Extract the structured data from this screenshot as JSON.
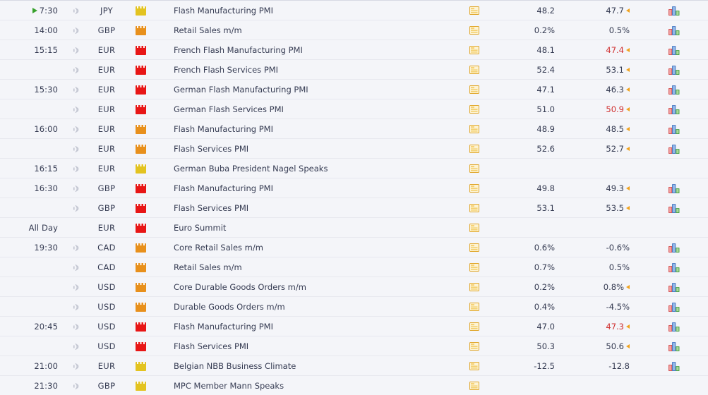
{
  "calendar": {
    "icons": {
      "sound": "speaker-icon",
      "detail": "folder-icon",
      "graph": "bar-graph-icon",
      "now": "now-marker-icon"
    },
    "rows": [
      {
        "time": "7:30",
        "now": true,
        "group_start": true,
        "sound": true,
        "currency": "JPY",
        "impact": "yellow",
        "impact_color": "#e3c320",
        "event": "Flash Manufacturing PMI",
        "detail": true,
        "actual": "48.2",
        "previous": "47.7",
        "previous_revised": false,
        "revision_arrow": true,
        "graph": true
      },
      {
        "time": "14:00",
        "now": false,
        "group_start": true,
        "sound": true,
        "currency": "GBP",
        "impact": "orange",
        "impact_color": "#e8901c",
        "event": "Retail Sales m/m",
        "detail": true,
        "actual": "0.2%",
        "previous": "0.5%",
        "previous_revised": false,
        "revision_arrow": false,
        "graph": true
      },
      {
        "time": "15:15",
        "now": false,
        "group_start": true,
        "sound": true,
        "currency": "EUR",
        "impact": "red",
        "impact_color": "#e81616",
        "event": "French Flash Manufacturing PMI",
        "detail": true,
        "actual": "48.1",
        "previous": "47.4",
        "previous_revised": true,
        "revision_arrow": true,
        "graph": true
      },
      {
        "time": "",
        "now": false,
        "group_start": false,
        "sound": true,
        "currency": "EUR",
        "impact": "red",
        "impact_color": "#e81616",
        "event": "French Flash Services PMI",
        "detail": true,
        "actual": "52.4",
        "previous": "53.1",
        "previous_revised": false,
        "revision_arrow": true,
        "graph": true
      },
      {
        "time": "15:30",
        "now": false,
        "group_start": true,
        "sound": true,
        "currency": "EUR",
        "impact": "red",
        "impact_color": "#e81616",
        "event": "German Flash Manufacturing PMI",
        "detail": true,
        "actual": "47.1",
        "previous": "46.3",
        "previous_revised": false,
        "revision_arrow": true,
        "graph": true
      },
      {
        "time": "",
        "now": false,
        "group_start": false,
        "sound": true,
        "currency": "EUR",
        "impact": "red",
        "impact_color": "#e81616",
        "event": "German Flash Services PMI",
        "detail": true,
        "actual": "51.0",
        "previous": "50.9",
        "previous_revised": true,
        "revision_arrow": true,
        "graph": true
      },
      {
        "time": "16:00",
        "now": false,
        "group_start": true,
        "sound": true,
        "currency": "EUR",
        "impact": "orange",
        "impact_color": "#e8901c",
        "event": "Flash Manufacturing PMI",
        "detail": true,
        "actual": "48.9",
        "previous": "48.5",
        "previous_revised": false,
        "revision_arrow": true,
        "graph": true
      },
      {
        "time": "",
        "now": false,
        "group_start": false,
        "sound": true,
        "currency": "EUR",
        "impact": "orange",
        "impact_color": "#e8901c",
        "event": "Flash Services PMI",
        "detail": true,
        "actual": "52.6",
        "previous": "52.7",
        "previous_revised": false,
        "revision_arrow": true,
        "graph": true
      },
      {
        "time": "16:15",
        "now": false,
        "group_start": true,
        "sound": true,
        "currency": "EUR",
        "impact": "yellow",
        "impact_color": "#e3c320",
        "event": "German Buba President Nagel Speaks",
        "detail": true,
        "actual": "",
        "previous": "",
        "previous_revised": false,
        "revision_arrow": false,
        "graph": false
      },
      {
        "time": "16:30",
        "now": false,
        "group_start": true,
        "sound": true,
        "currency": "GBP",
        "impact": "red",
        "impact_color": "#e81616",
        "event": "Flash Manufacturing PMI",
        "detail": true,
        "actual": "49.8",
        "previous": "49.3",
        "previous_revised": false,
        "revision_arrow": true,
        "graph": true
      },
      {
        "time": "",
        "now": false,
        "group_start": false,
        "sound": true,
        "currency": "GBP",
        "impact": "red",
        "impact_color": "#e81616",
        "event": "Flash Services PMI",
        "detail": true,
        "actual": "53.1",
        "previous": "53.5",
        "previous_revised": false,
        "revision_arrow": true,
        "graph": true
      },
      {
        "time": "All Day",
        "now": false,
        "group_start": true,
        "sound": false,
        "currency": "EUR",
        "impact": "red",
        "impact_color": "#e81616",
        "event": "Euro Summit",
        "detail": true,
        "actual": "",
        "previous": "",
        "previous_revised": false,
        "revision_arrow": false,
        "graph": false
      },
      {
        "time": "19:30",
        "now": false,
        "group_start": true,
        "sound": true,
        "currency": "CAD",
        "impact": "orange",
        "impact_color": "#e8901c",
        "event": "Core Retail Sales m/m",
        "detail": true,
        "actual": "0.6%",
        "previous": "-0.6%",
        "previous_revised": false,
        "revision_arrow": false,
        "graph": true
      },
      {
        "time": "",
        "now": false,
        "group_start": false,
        "sound": true,
        "currency": "CAD",
        "impact": "orange",
        "impact_color": "#e8901c",
        "event": "Retail Sales m/m",
        "detail": true,
        "actual": "0.7%",
        "previous": "0.5%",
        "previous_revised": false,
        "revision_arrow": false,
        "graph": true
      },
      {
        "time": "",
        "now": false,
        "group_start": false,
        "sound": true,
        "currency": "USD",
        "impact": "orange",
        "impact_color": "#e8901c",
        "event": "Core Durable Goods Orders m/m",
        "detail": true,
        "actual": "0.2%",
        "previous": "0.8%",
        "previous_revised": false,
        "revision_arrow": true,
        "graph": true
      },
      {
        "time": "",
        "now": false,
        "group_start": false,
        "sound": true,
        "currency": "USD",
        "impact": "orange",
        "impact_color": "#e8901c",
        "event": "Durable Goods Orders m/m",
        "detail": true,
        "actual": "0.4%",
        "previous": "-4.5%",
        "previous_revised": false,
        "revision_arrow": false,
        "graph": true
      },
      {
        "time": "20:45",
        "now": false,
        "group_start": true,
        "sound": true,
        "currency": "USD",
        "impact": "red",
        "impact_color": "#e81616",
        "event": "Flash Manufacturing PMI",
        "detail": true,
        "actual": "47.0",
        "previous": "47.3",
        "previous_revised": true,
        "revision_arrow": true,
        "graph": true
      },
      {
        "time": "",
        "now": false,
        "group_start": false,
        "sound": true,
        "currency": "USD",
        "impact": "red",
        "impact_color": "#e81616",
        "event": "Flash Services PMI",
        "detail": true,
        "actual": "50.3",
        "previous": "50.6",
        "previous_revised": false,
        "revision_arrow": true,
        "graph": true
      },
      {
        "time": "21:00",
        "now": false,
        "group_start": true,
        "sound": true,
        "currency": "EUR",
        "impact": "yellow",
        "impact_color": "#e3c320",
        "event": "Belgian NBB Business Climate",
        "detail": true,
        "actual": "-12.5",
        "previous": "-12.8",
        "previous_revised": false,
        "revision_arrow": false,
        "graph": true
      },
      {
        "time": "21:30",
        "now": false,
        "group_start": true,
        "sound": true,
        "currency": "GBP",
        "impact": "yellow",
        "impact_color": "#e3c320",
        "event": "MPC Member Mann Speaks",
        "detail": true,
        "actual": "",
        "previous": "",
        "previous_revised": false,
        "revision_arrow": false,
        "graph": false
      }
    ]
  }
}
